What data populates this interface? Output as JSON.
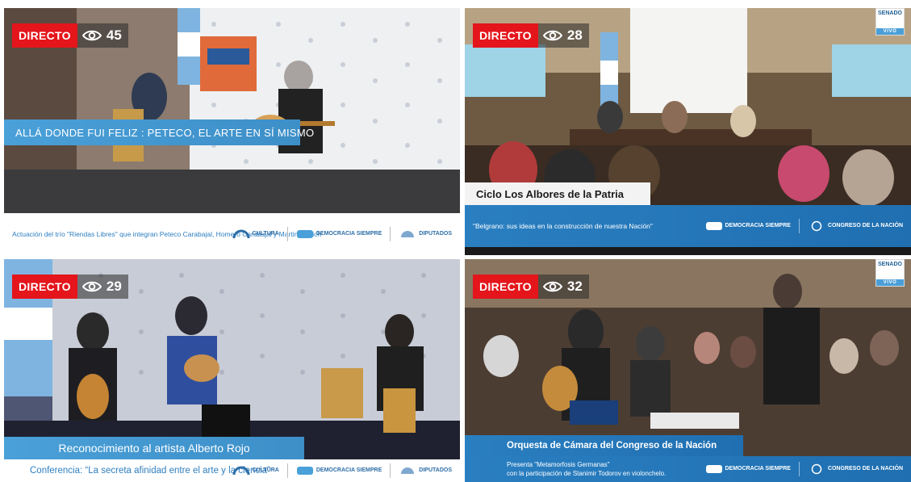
{
  "tiles": [
    {
      "live_label": "DIRECTO",
      "viewers": "45",
      "title": "ALLÁ DONDE FUI FELIZ : PETECO, EL ARTE EN SÍ MISMO",
      "subtitle": "Actuación del trío \"Riendas Libres\" que integran Peteco Carabajal, Homero Carabajal y Martina Ulrich",
      "logos": [
        "CULTURA",
        "DEMOCRACIA SIEMPRE",
        "DIPUTADOS"
      ]
    },
    {
      "live_label": "DIRECTO",
      "viewers": "28",
      "title": "Ciclo Los Albores de la Patria",
      "subtitle": "\"Belgrano: sus ideas en la construcción de nuestra Nación\"",
      "logos": [
        "DEMOCRACIA SIEMPRE",
        "CONGRESO DE LA NACIÓN"
      ],
      "badge": {
        "top": "SENADO",
        "bottom": "VIVO"
      }
    },
    {
      "live_label": "DIRECTO",
      "viewers": "29",
      "title": "Reconocimiento al artista Alberto Rojo",
      "subtitle": "Conferencia: “La secreta afinidad entre el arte y la ciencia”",
      "logos": [
        "CULTURA",
        "DEMOCRACIA SIEMPRE",
        "DIPUTADOS"
      ]
    },
    {
      "live_label": "DIRECTO",
      "viewers": "32",
      "title": "Orquesta de Cámara del Congreso de la Nación",
      "subtitle_line1": "Presenta \"Metamorfosis Germanas\"",
      "subtitle_line2": "con la participación de Stanimir Todorov en violonchelo.",
      "logos": [
        "DEMOCRACIA SIEMPRE",
        "CONGRESO DE LA NACIÓN"
      ],
      "badge": {
        "top": "SENADO",
        "bottom": "VIVO"
      }
    }
  ],
  "colors": {
    "live_red": "#e4151b",
    "accent_blue": "#3d8fc8",
    "deep_blue": "#1f6fb1"
  },
  "icons": {
    "viewers": "eye-icon"
  }
}
